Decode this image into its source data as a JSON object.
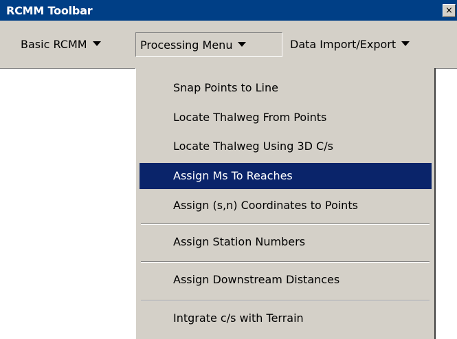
{
  "window": {
    "title": "RCMM Toolbar",
    "close_glyph": "×"
  },
  "menubar": {
    "items": [
      {
        "label": "Basic RCMM"
      },
      {
        "label": "Processing Menu"
      },
      {
        "label": "Data Import/Export"
      }
    ]
  },
  "dropdown": {
    "items": [
      {
        "label": "Snap Points to Line"
      },
      {
        "label": "Locate Thalweg From Points"
      },
      {
        "label": "Locate Thalweg Using 3D C/s"
      },
      {
        "label": "Assign Ms To Reaches"
      },
      {
        "label": "Assign (s,n) Coordinates to Points"
      },
      {
        "label": "Assign Station Numbers"
      },
      {
        "label": "Assign Downstream Distances"
      },
      {
        "label": "Intgrate c/s with Terrain"
      }
    ],
    "selected_index": 3
  },
  "colors": {
    "titlebar": "#003f86",
    "face": "#d4d0c8",
    "selection": "#0a246a"
  },
  "icons": {
    "close": "close-icon",
    "dropdown_arrow": "chevron-down-icon"
  }
}
